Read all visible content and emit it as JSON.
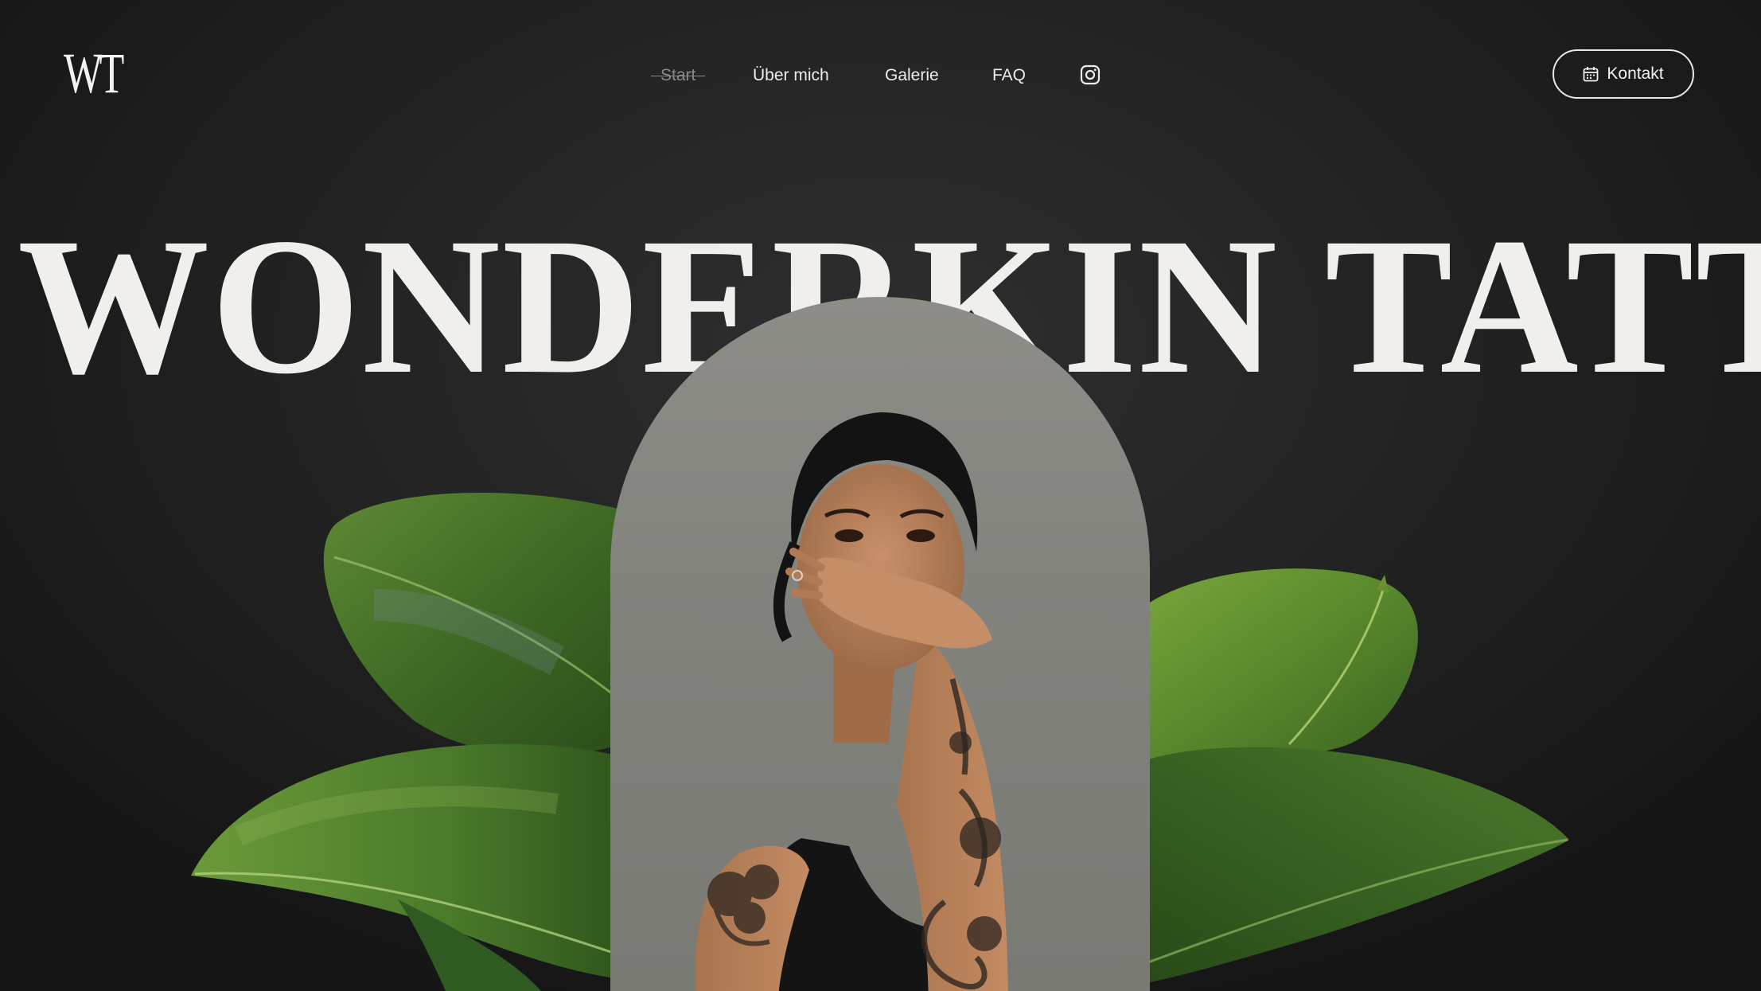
{
  "brand": {
    "logo_text": "WT"
  },
  "nav": {
    "items": [
      {
        "label": "Start",
        "active": true
      },
      {
        "label": "Über mich",
        "active": false
      },
      {
        "label": "Galerie",
        "active": false
      },
      {
        "label": "FAQ",
        "active": false
      }
    ],
    "instagram_icon": "instagram-icon"
  },
  "contact_button": {
    "label": "Kontakt",
    "icon": "calendar-icon"
  },
  "hero": {
    "title": "WONDERKIN TATTOO",
    "image_alt": "tattooed-woman-portrait",
    "decoration": "green-leaves"
  },
  "colors": {
    "background": "#222222",
    "text": "#f1efec",
    "nav_active": "#8a8a8a",
    "arch_bg": "#84847f",
    "leaf": "#4f7a2c"
  }
}
